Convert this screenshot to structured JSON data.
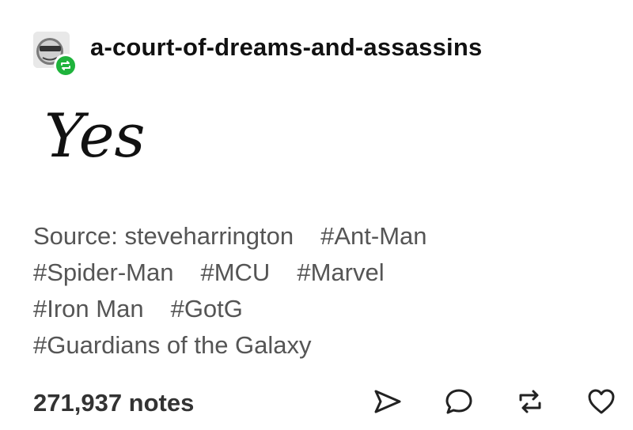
{
  "post": {
    "blog_name": "a-court-of-dreams-and-assassins",
    "avatar_icon": "cartoon-face-avatar",
    "reblog_badge_icon": "reblog-icon",
    "reblog_badge_color": "#1fb33c",
    "body_text": "Yes",
    "source_label": "Source: steveharrington",
    "tags": [
      "#Ant-Man",
      "#Spider-Man",
      "#MCU",
      "#Marvel",
      "#Iron Man",
      "#GotG",
      "#Guardians of the Galaxy"
    ],
    "notes": "271,937 notes"
  },
  "actions": {
    "share_icon": "paper-plane-icon",
    "reply_icon": "speech-bubble-icon",
    "reblog_icon": "reblog-icon",
    "like_icon": "heart-icon"
  }
}
